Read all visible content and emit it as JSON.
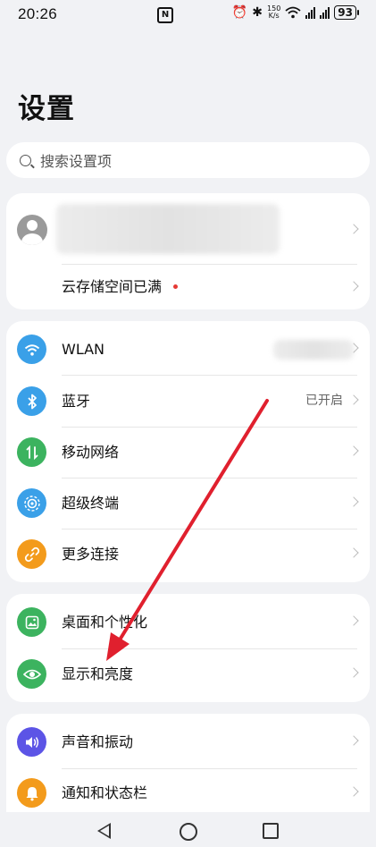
{
  "status_bar": {
    "time": "20:26",
    "nfc": "N",
    "speed_value": "150",
    "speed_unit": "K/s",
    "battery": "93"
  },
  "page_title": "设置",
  "search": {
    "placeholder": "搜索设置项"
  },
  "account": {
    "cloud_storage": "云存储空间已满"
  },
  "connectivity": [
    {
      "label": "WLAN",
      "icon": "wifi-icon",
      "color": "#3aa0e8"
    },
    {
      "label": "蓝牙",
      "icon": "bluetooth-icon",
      "color": "#3aa0e8",
      "value": "已开启"
    },
    {
      "label": "移动网络",
      "icon": "mobile-network-icon",
      "color": "#3cb35f"
    },
    {
      "label": "超级终端",
      "icon": "super-device-icon",
      "color": "#3aa0e8"
    },
    {
      "label": "更多连接",
      "icon": "link-icon",
      "color": "#f39b1c"
    }
  ],
  "display": [
    {
      "label": "桌面和个性化",
      "icon": "wallpaper-icon",
      "color": "#3cb35f"
    },
    {
      "label": "显示和亮度",
      "icon": "eye-icon",
      "color": "#3cb35f"
    }
  ],
  "sound": [
    {
      "label": "声音和振动",
      "icon": "speaker-icon",
      "color": "#5c54e6"
    },
    {
      "label": "通知和状态栏",
      "icon": "bell-icon",
      "color": "#f39b1c"
    }
  ],
  "colors": {
    "annotation_arrow": "#e0202e",
    "background": "#f1f2f5"
  }
}
